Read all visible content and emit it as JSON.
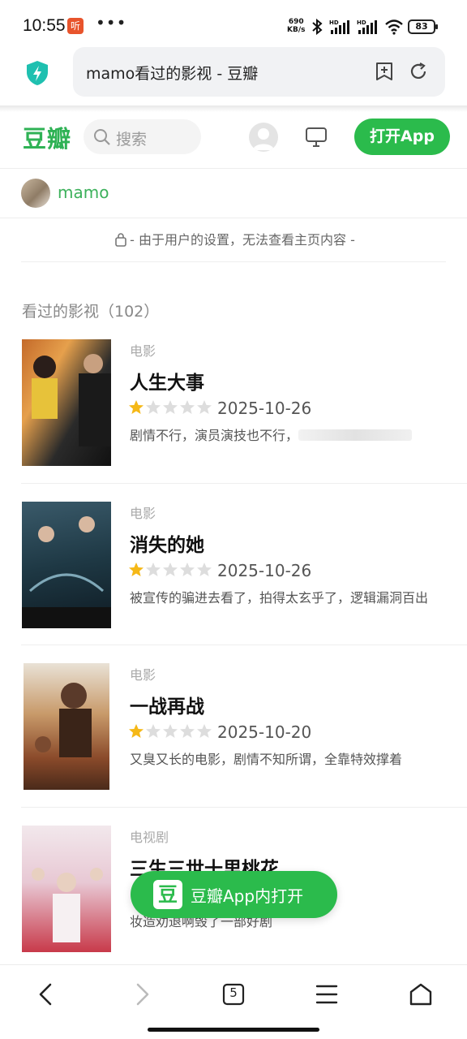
{
  "status_bar": {
    "time": "10:55",
    "app_badge": "听",
    "more": "•••",
    "net_speed_value": "690",
    "net_speed_unit": "KB/s",
    "battery": "83"
  },
  "url_bar": {
    "title": "mamo看过的影视 - 豆瓣"
  },
  "header": {
    "logo": "豆瓣",
    "search_placeholder": "搜索",
    "open_app_label": "打开App"
  },
  "user": {
    "name": "mamo"
  },
  "privacy_notice": "- 由于用户的设置，无法查看主页内容 -",
  "section": {
    "title": "看过的影视（102）"
  },
  "items": [
    {
      "type": "电影",
      "title": "人生大事",
      "rating": 1,
      "rating_max": 5,
      "date": "2025-10-26",
      "comment": "剧情不行，演员演技也不行，"
    },
    {
      "type": "电影",
      "title": "消失的她",
      "rating": 1,
      "rating_max": 5,
      "date": "2025-10-26",
      "comment": "被宣传的骗进去看了，拍得太玄乎了，逻辑漏洞百出"
    },
    {
      "type": "电影",
      "title": "一战再战",
      "rating": 1,
      "rating_max": 5,
      "date": "2025-10-20",
      "comment": "又臭又长的电影，剧情不知所谓，全靠特效撑着"
    },
    {
      "type": "电视剧",
      "title": "三生三世十里桃花",
      "comment": "妆造劝退啊毁了一部好剧"
    }
  ],
  "float_button": {
    "logo": "豆",
    "label": "豆瓣App内打开"
  },
  "bottom_nav": {
    "tabs_count": "5"
  },
  "colors": {
    "brand_green": "#2bbb4c",
    "star_gold": "#f5b817",
    "star_gray": "#dddddd"
  }
}
